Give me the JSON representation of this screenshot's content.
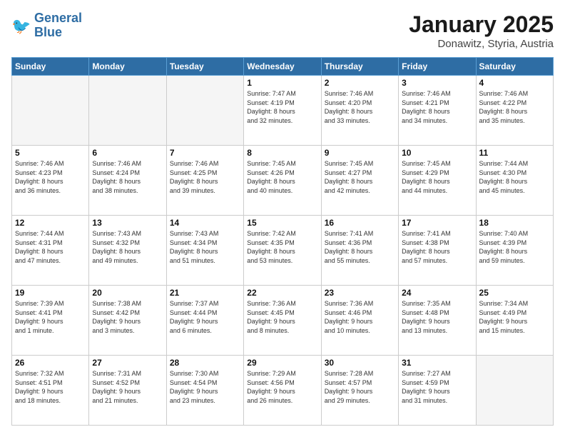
{
  "header": {
    "logo_line1": "General",
    "logo_line2": "Blue",
    "month": "January 2025",
    "location": "Donawitz, Styria, Austria"
  },
  "days_of_week": [
    "Sunday",
    "Monday",
    "Tuesday",
    "Wednesday",
    "Thursday",
    "Friday",
    "Saturday"
  ],
  "weeks": [
    [
      {
        "day": "",
        "info": ""
      },
      {
        "day": "",
        "info": ""
      },
      {
        "day": "",
        "info": ""
      },
      {
        "day": "1",
        "info": "Sunrise: 7:47 AM\nSunset: 4:19 PM\nDaylight: 8 hours\nand 32 minutes."
      },
      {
        "day": "2",
        "info": "Sunrise: 7:46 AM\nSunset: 4:20 PM\nDaylight: 8 hours\nand 33 minutes."
      },
      {
        "day": "3",
        "info": "Sunrise: 7:46 AM\nSunset: 4:21 PM\nDaylight: 8 hours\nand 34 minutes."
      },
      {
        "day": "4",
        "info": "Sunrise: 7:46 AM\nSunset: 4:22 PM\nDaylight: 8 hours\nand 35 minutes."
      }
    ],
    [
      {
        "day": "5",
        "info": "Sunrise: 7:46 AM\nSunset: 4:23 PM\nDaylight: 8 hours\nand 36 minutes."
      },
      {
        "day": "6",
        "info": "Sunrise: 7:46 AM\nSunset: 4:24 PM\nDaylight: 8 hours\nand 38 minutes."
      },
      {
        "day": "7",
        "info": "Sunrise: 7:46 AM\nSunset: 4:25 PM\nDaylight: 8 hours\nand 39 minutes."
      },
      {
        "day": "8",
        "info": "Sunrise: 7:45 AM\nSunset: 4:26 PM\nDaylight: 8 hours\nand 40 minutes."
      },
      {
        "day": "9",
        "info": "Sunrise: 7:45 AM\nSunset: 4:27 PM\nDaylight: 8 hours\nand 42 minutes."
      },
      {
        "day": "10",
        "info": "Sunrise: 7:45 AM\nSunset: 4:29 PM\nDaylight: 8 hours\nand 44 minutes."
      },
      {
        "day": "11",
        "info": "Sunrise: 7:44 AM\nSunset: 4:30 PM\nDaylight: 8 hours\nand 45 minutes."
      }
    ],
    [
      {
        "day": "12",
        "info": "Sunrise: 7:44 AM\nSunset: 4:31 PM\nDaylight: 8 hours\nand 47 minutes."
      },
      {
        "day": "13",
        "info": "Sunrise: 7:43 AM\nSunset: 4:32 PM\nDaylight: 8 hours\nand 49 minutes."
      },
      {
        "day": "14",
        "info": "Sunrise: 7:43 AM\nSunset: 4:34 PM\nDaylight: 8 hours\nand 51 minutes."
      },
      {
        "day": "15",
        "info": "Sunrise: 7:42 AM\nSunset: 4:35 PM\nDaylight: 8 hours\nand 53 minutes."
      },
      {
        "day": "16",
        "info": "Sunrise: 7:41 AM\nSunset: 4:36 PM\nDaylight: 8 hours\nand 55 minutes."
      },
      {
        "day": "17",
        "info": "Sunrise: 7:41 AM\nSunset: 4:38 PM\nDaylight: 8 hours\nand 57 minutes."
      },
      {
        "day": "18",
        "info": "Sunrise: 7:40 AM\nSunset: 4:39 PM\nDaylight: 8 hours\nand 59 minutes."
      }
    ],
    [
      {
        "day": "19",
        "info": "Sunrise: 7:39 AM\nSunset: 4:41 PM\nDaylight: 9 hours\nand 1 minute."
      },
      {
        "day": "20",
        "info": "Sunrise: 7:38 AM\nSunset: 4:42 PM\nDaylight: 9 hours\nand 3 minutes."
      },
      {
        "day": "21",
        "info": "Sunrise: 7:37 AM\nSunset: 4:44 PM\nDaylight: 9 hours\nand 6 minutes."
      },
      {
        "day": "22",
        "info": "Sunrise: 7:36 AM\nSunset: 4:45 PM\nDaylight: 9 hours\nand 8 minutes."
      },
      {
        "day": "23",
        "info": "Sunrise: 7:36 AM\nSunset: 4:46 PM\nDaylight: 9 hours\nand 10 minutes."
      },
      {
        "day": "24",
        "info": "Sunrise: 7:35 AM\nSunset: 4:48 PM\nDaylight: 9 hours\nand 13 minutes."
      },
      {
        "day": "25",
        "info": "Sunrise: 7:34 AM\nSunset: 4:49 PM\nDaylight: 9 hours\nand 15 minutes."
      }
    ],
    [
      {
        "day": "26",
        "info": "Sunrise: 7:32 AM\nSunset: 4:51 PM\nDaylight: 9 hours\nand 18 minutes."
      },
      {
        "day": "27",
        "info": "Sunrise: 7:31 AM\nSunset: 4:52 PM\nDaylight: 9 hours\nand 21 minutes."
      },
      {
        "day": "28",
        "info": "Sunrise: 7:30 AM\nSunset: 4:54 PM\nDaylight: 9 hours\nand 23 minutes."
      },
      {
        "day": "29",
        "info": "Sunrise: 7:29 AM\nSunset: 4:56 PM\nDaylight: 9 hours\nand 26 minutes."
      },
      {
        "day": "30",
        "info": "Sunrise: 7:28 AM\nSunset: 4:57 PM\nDaylight: 9 hours\nand 29 minutes."
      },
      {
        "day": "31",
        "info": "Sunrise: 7:27 AM\nSunset: 4:59 PM\nDaylight: 9 hours\nand 31 minutes."
      },
      {
        "day": "",
        "info": ""
      }
    ]
  ]
}
